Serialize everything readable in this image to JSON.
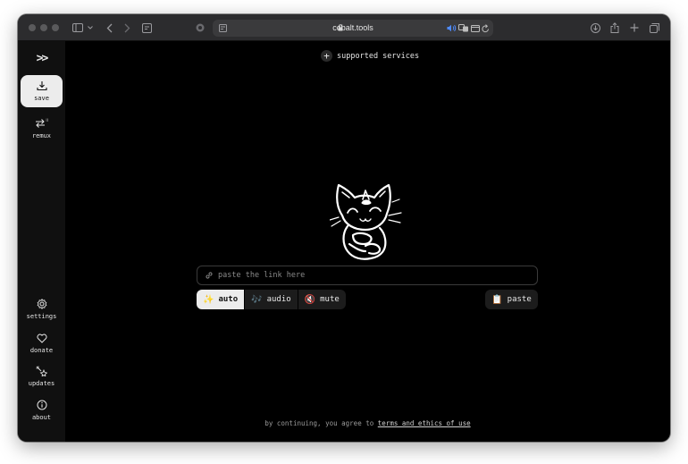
{
  "browser": {
    "url": "cobalt.tools"
  },
  "sidebar": {
    "logo": ">>",
    "items": [
      {
        "label": "save",
        "icon": "download-icon",
        "active": true
      },
      {
        "label": "remux",
        "icon": "remux-icon",
        "active": false
      }
    ],
    "bottom_items": [
      {
        "label": "settings",
        "icon": "gear-icon"
      },
      {
        "label": "donate",
        "icon": "heart-icon"
      },
      {
        "label": "updates",
        "icon": "sparkle-icon"
      },
      {
        "label": "about",
        "icon": "info-icon"
      }
    ]
  },
  "main": {
    "supported_services": "supported services",
    "input": {
      "placeholder": "paste the link here",
      "value": ""
    },
    "modes": [
      {
        "emoji": "✨",
        "label": "auto",
        "active": true
      },
      {
        "emoji": "🎶",
        "label": "audio",
        "active": false
      },
      {
        "emoji": "🔇",
        "label": "mute",
        "active": false
      }
    ],
    "paste": {
      "emoji": "📋",
      "label": "paste"
    },
    "footer": {
      "prefix": "by continuing, you agree to",
      "link": "terms and ethics of use"
    }
  },
  "colors": {
    "background": "#000000",
    "sidebar": "#101010",
    "active_fill": "#ececec",
    "text": "#e6e6e6"
  }
}
